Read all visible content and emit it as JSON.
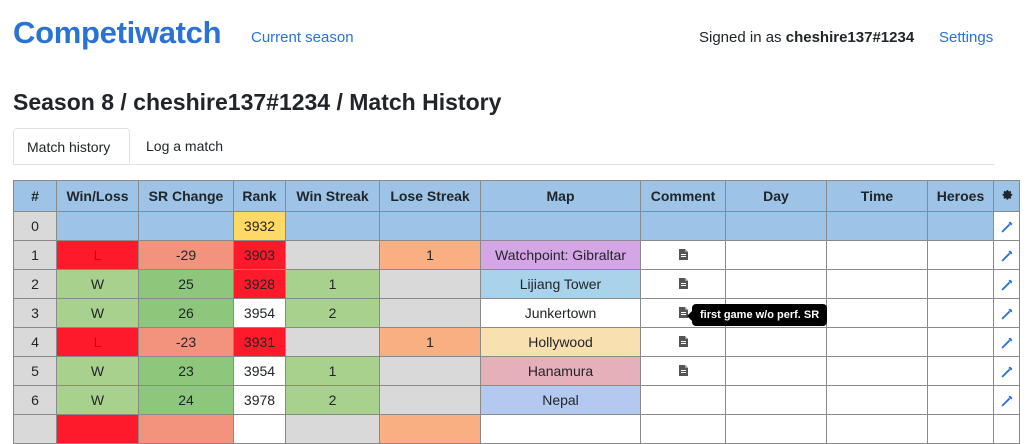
{
  "header": {
    "brand": "Competiwatch",
    "current_season": "Current season",
    "signed_in_prefix": "Signed in as ",
    "username": "cheshire137#1234",
    "settings": "Settings"
  },
  "page_title": "Season 8 / cheshire137#1234 / Match History",
  "tabs": [
    {
      "label": "Match history",
      "active": true
    },
    {
      "label": "Log a match",
      "active": false
    }
  ],
  "table": {
    "columns": [
      "#",
      "Win/Loss",
      "SR Change",
      "Rank",
      "Win Streak",
      "Lose Streak",
      "Map",
      "Comment",
      "Day",
      "Time",
      "Heroes"
    ],
    "settings_icon": "gear-icon",
    "rows": [
      {
        "num": "0",
        "result": "",
        "sr_change": "",
        "rank": "3932",
        "win_streak": "",
        "lose_streak": "",
        "map": "",
        "comment": false
      },
      {
        "num": "1",
        "result": "L",
        "sr_change": "-29",
        "rank": "3903",
        "win_streak": "",
        "lose_streak": "1",
        "map": "Watchpoint: Gibraltar",
        "comment": true
      },
      {
        "num": "2",
        "result": "W",
        "sr_change": "25",
        "rank": "3928",
        "win_streak": "1",
        "lose_streak": "",
        "map": "Lijiang Tower",
        "comment": true
      },
      {
        "num": "3",
        "result": "W",
        "sr_change": "26",
        "rank": "3954",
        "win_streak": "2",
        "lose_streak": "",
        "map": "Junkertown",
        "comment": true
      },
      {
        "num": "4",
        "result": "L",
        "sr_change": "-23",
        "rank": "3931",
        "win_streak": "",
        "lose_streak": "1",
        "map": "Hollywood",
        "comment": true
      },
      {
        "num": "5",
        "result": "W",
        "sr_change": "23",
        "rank": "3954",
        "win_streak": "1",
        "lose_streak": "",
        "map": "Hanamura",
        "comment": true
      },
      {
        "num": "6",
        "result": "W",
        "sr_change": "24",
        "rank": "3978",
        "win_streak": "2",
        "lose_streak": "",
        "map": "Nepal",
        "comment": false
      }
    ]
  },
  "tooltip": "first game w/o perf. SR",
  "colors": {
    "brand": "#2a72d4",
    "header_bg": "#9dc3e6",
    "loss": "#ff1a2b",
    "win": "#a9d18e",
    "map_watchpoint": "#d5a6e6",
    "map_lijiang": "#a9d3ea",
    "map_junkertown": "#ffffff",
    "map_hollywood": "#f9e0b0",
    "map_hanamura": "#e6b0b8",
    "map_nepal": "#b4c9f0"
  }
}
